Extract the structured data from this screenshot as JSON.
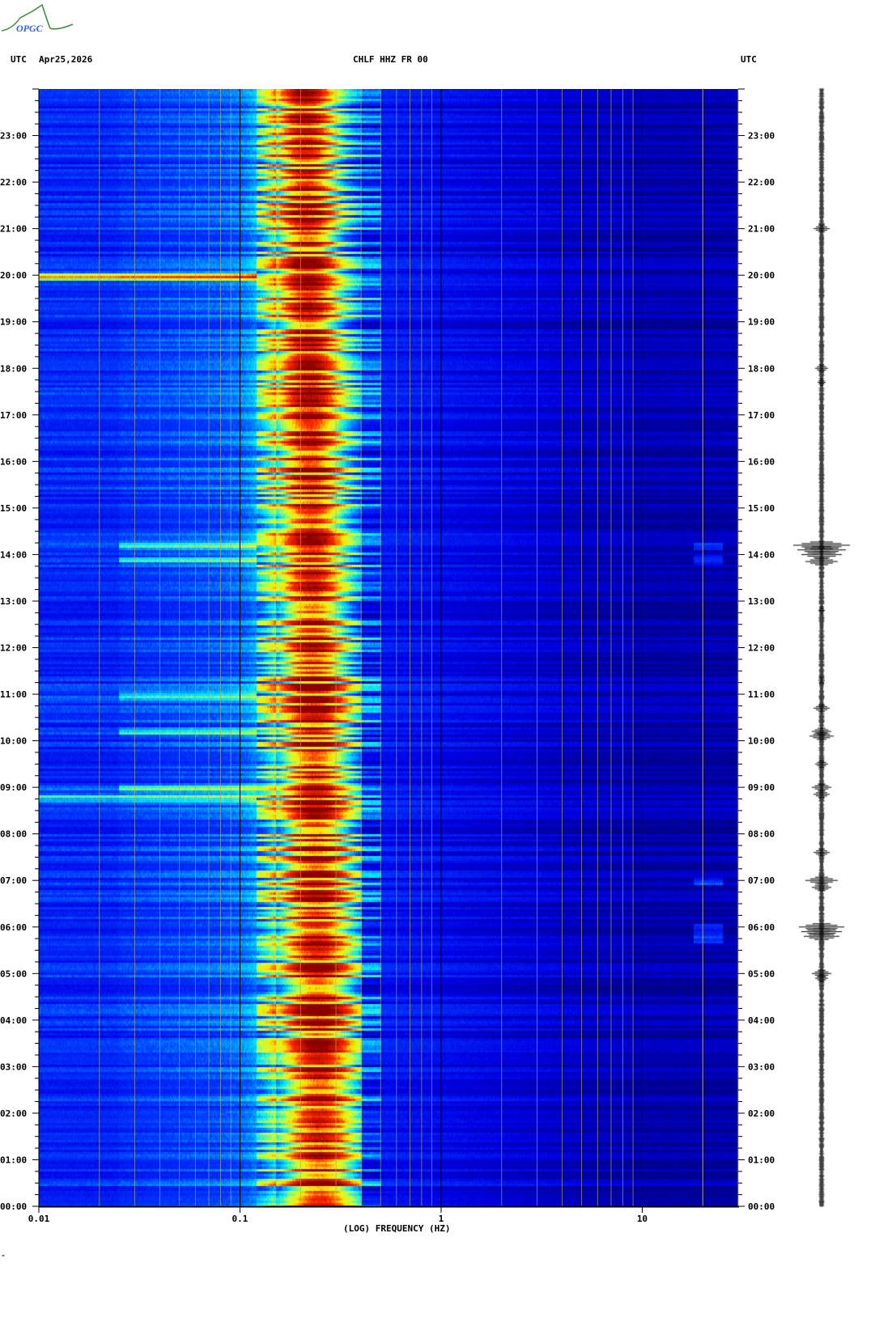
{
  "header": {
    "left_tz": "UTC",
    "date": "Apr25,2026",
    "station": "CHLF HHZ FR 00",
    "right_tz": "UTC",
    "logo_text": "OPGC"
  },
  "chart_data": {
    "type": "heatmap",
    "title": "CHLF HHZ FR 00",
    "xlabel": "(LOG) FREQUENCY (HZ)",
    "ylabel": "UTC",
    "xscale": "log",
    "xlim": [
      0.01,
      30
    ],
    "x_ticks": [
      "0.01",
      "0.1",
      "1",
      "10"
    ],
    "x_tick_values": [
      0.01,
      0.1,
      1,
      10
    ],
    "ylim_hours": [
      0,
      24
    ],
    "y_ticks": [
      "00:00",
      "01:00",
      "02:00",
      "03:00",
      "04:00",
      "05:00",
      "06:00",
      "07:00",
      "08:00",
      "09:00",
      "10:00",
      "11:00",
      "12:00",
      "13:00",
      "14:00",
      "15:00",
      "16:00",
      "17:00",
      "18:00",
      "19:00",
      "20:00",
      "21:00",
      "22:00",
      "23:00"
    ],
    "colormap": [
      "#00008b",
      "#0000ff",
      "#00ffff",
      "#ffff00",
      "#ff0000",
      "#8b0000"
    ],
    "microseism_peak_hz": [
      0.15,
      0.4
    ],
    "events_utc_hours": [
      20.0,
      11.0,
      10.2,
      9.0,
      8.8,
      14.2,
      13.9,
      7.0,
      5.8,
      6.0,
      5.0
    ]
  },
  "footer": {
    "mark": "\""
  }
}
